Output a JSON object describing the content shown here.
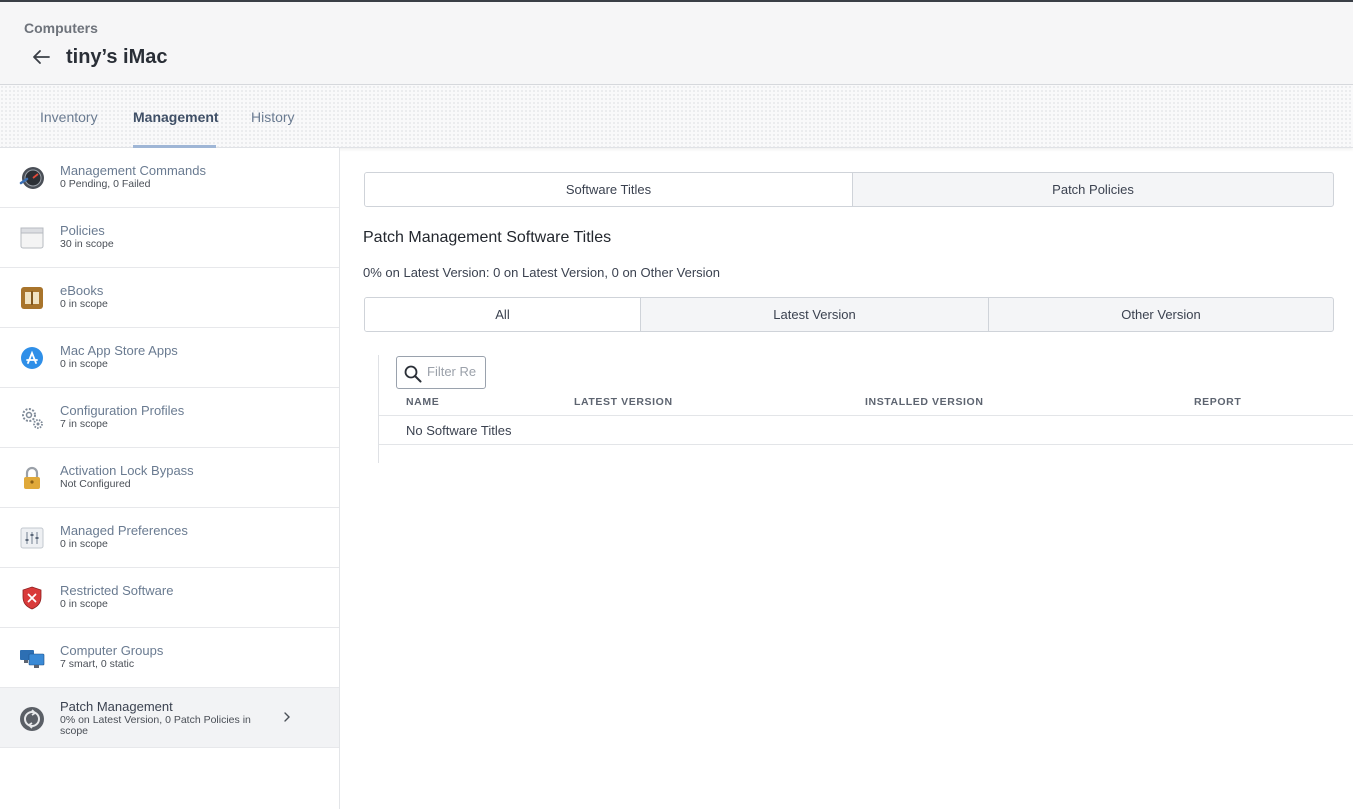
{
  "header": {
    "breadcrumb": "Computers",
    "title": "tiny’s iMac"
  },
  "tabs": [
    {
      "label": "Inventory",
      "active": false
    },
    {
      "label": "Management",
      "active": true
    },
    {
      "label": "History",
      "active": false
    }
  ],
  "sidebar": {
    "items": [
      {
        "label": "Management Commands",
        "sub": "0 Pending, 0 Failed",
        "icon": "management-commands-icon"
      },
      {
        "label": "Policies",
        "sub": "30 in scope",
        "icon": "policies-icon"
      },
      {
        "label": "eBooks",
        "sub": "0 in scope",
        "icon": "ebooks-icon"
      },
      {
        "label": "Mac App Store Apps",
        "sub": "0 in scope",
        "icon": "app-store-icon"
      },
      {
        "label": "Configuration Profiles",
        "sub": "7 in scope",
        "icon": "configuration-profiles-icon"
      },
      {
        "label": "Activation Lock Bypass",
        "sub": "Not Configured",
        "icon": "lock-icon"
      },
      {
        "label": "Managed Preferences",
        "sub": "0 in scope",
        "icon": "managed-preferences-icon"
      },
      {
        "label": "Restricted Software",
        "sub": "0 in scope",
        "icon": "restricted-software-icon"
      },
      {
        "label": "Computer Groups",
        "sub": "7 smart, 0 static",
        "icon": "computer-groups-icon"
      },
      {
        "label": "Patch Management",
        "sub": "0% on Latest Version, 0 Patch Policies in scope",
        "icon": "patch-management-icon",
        "active": true
      }
    ]
  },
  "main": {
    "view_toggle": [
      "Software Titles",
      "Patch Policies"
    ],
    "section_title": "Patch Management Software Titles",
    "summary": "0% on Latest Version: 0 on Latest Version, 0 on Other Version",
    "filter_tabs": [
      "All",
      "Latest Version",
      "Other Version"
    ],
    "filter": {
      "placeholder": "Filter Re",
      "value": ""
    },
    "table": {
      "columns": [
        "NAME",
        "LATEST VERSION",
        "INSTALLED VERSION",
        "REPORT"
      ],
      "empty_text": "No Software Titles"
    }
  }
}
